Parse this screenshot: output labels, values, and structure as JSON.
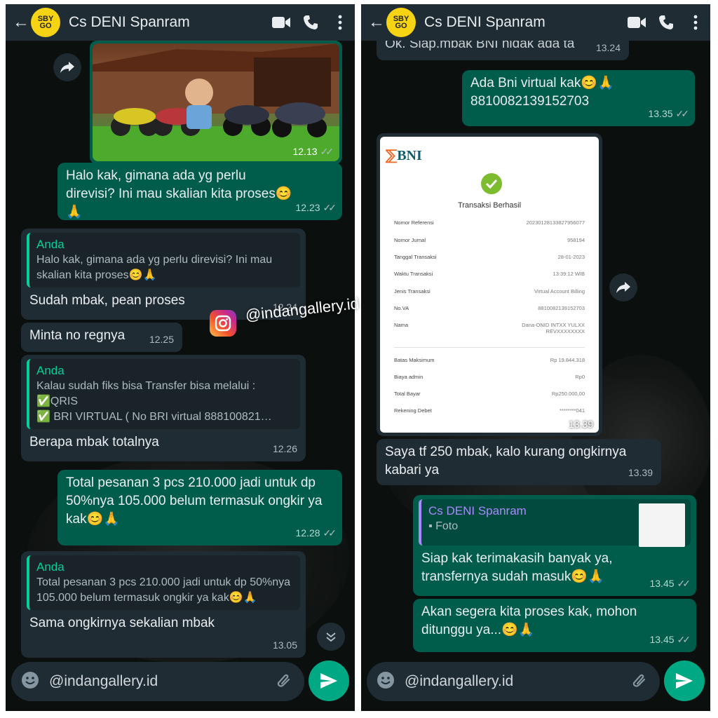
{
  "header": {
    "contact": "Cs DENI Spanram",
    "avatar_text_1": "SBY",
    "avatar_text_2": "GO"
  },
  "watermark": "@indangallery.id",
  "left": {
    "photo": {
      "time": "12.13"
    },
    "messages": [
      {
        "type": "out",
        "text": "Halo kak, gimana ada yg perlu direvisi? Ini mau skalian kita proses😊🙏",
        "time": "12.23"
      },
      {
        "type": "in",
        "quote_name": "Anda",
        "quote_text": "Halo kak, gimana ada yg perlu direvisi? Ini mau skalian kita proses😊🙏",
        "text": "Sudah mbak, pean proses",
        "time": "12.24"
      },
      {
        "type": "in",
        "text": "Minta no regnya",
        "time": "12.25"
      },
      {
        "type": "in",
        "quote_name": "Anda",
        "quote_text": "Kalau sudah fiks bisa Transfer bisa melalui :",
        "quote_line2": "✅QRIS",
        "quote_line3": "✅ BRI VIRTUAL ( No BRI virtual 888100821…",
        "text": "Berapa mbak totalnya",
        "time": "12.26"
      },
      {
        "type": "out",
        "text": "Total pesanan 3 pcs 210.000 jadi untuk dp 50%nya 105.000 belum termasuk ongkir ya kak😊🙏",
        "time": "12.28"
      },
      {
        "type": "in",
        "quote_name": "Anda",
        "quote_text": "Total pesanan 3 pcs 210.000 jadi untuk dp 50%nya 105.000 belum termasuk ongkir ya kak😊🙏",
        "text": "Sama ongkirnya sekalian mbak",
        "time": "13.05"
      }
    ],
    "input_text": "@indangallery.id"
  },
  "right": {
    "messages": [
      {
        "type": "in",
        "text": "Ok. Siap.mbak BNI nidak ada ta",
        "time": "13.24"
      },
      {
        "type": "out",
        "text": "Ada Bni virtual kak😊🙏",
        "text2": "8810082139152703",
        "time": "13.35"
      },
      {
        "type": "in",
        "text": "Saya tf 250 mbak, kalo kurang ongkirnya kabari ya",
        "time": "13.39"
      },
      {
        "type": "out",
        "quote_name": "Cs DENI Spanram",
        "quote_text": "Foto",
        "text": "Siap kak terimakasih banyak ya, transfernya sudah masuk😊🙏",
        "time": "13.45"
      },
      {
        "type": "out",
        "text": "Akan segera kita proses kak, mohon ditunggu ya...😊🙏",
        "time": "13.45"
      }
    ],
    "receipt": {
      "bank": "BNI",
      "title": "Transaksi Berhasil",
      "time": "13.39",
      "rows": [
        {
          "label": "Nomor Referensi",
          "value": "20230128133827956077"
        },
        {
          "label": "Nomor Jurnal",
          "value": "958194"
        },
        {
          "label": "Tanggal Transaksi",
          "value": "28-01-2023"
        },
        {
          "label": "Waktu Transaksi",
          "value": "13:39:12 WIB"
        },
        {
          "label": "Jenis Transaksi",
          "value": "Virtual Account Billing"
        },
        {
          "label": "No.VA",
          "value": "8810082139152703"
        },
        {
          "label": "Nama",
          "value": "Dana-ONID INTXX YULXX REVXXXXXXXX"
        },
        {
          "label": "Batas Maksimum",
          "value": "Rp 19.844.318"
        },
        {
          "label": "Biaya admin",
          "value": "Rp0"
        },
        {
          "label": "Total Bayar",
          "value": "Rp250.000,00"
        },
        {
          "label": "Rekening Debet",
          "value": "********041"
        }
      ]
    },
    "input_text": "@indangallery.id"
  }
}
